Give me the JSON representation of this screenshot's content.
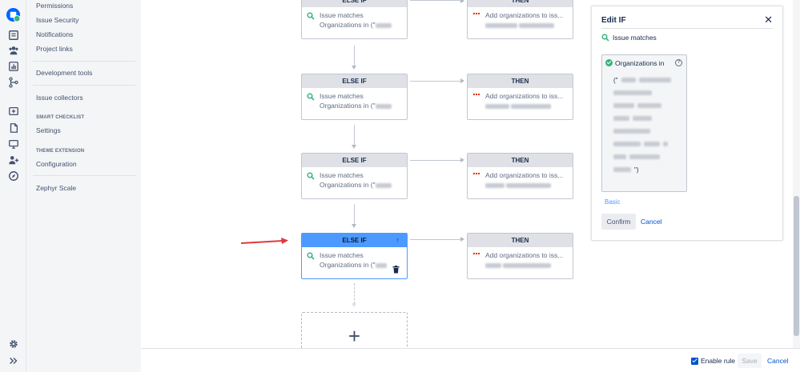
{
  "sidebar": {
    "items": [
      {
        "label": "Permissions"
      },
      {
        "label": "Issue Security"
      },
      {
        "label": "Notifications"
      },
      {
        "label": "Project links"
      },
      {
        "label": "Development tools"
      },
      {
        "label": "Issue collectors"
      },
      {
        "label": "Settings"
      },
      {
        "label": "Configuration"
      },
      {
        "label": "Zephyr Scale"
      }
    ],
    "sections": {
      "smart_checklist": "SMART CHECKLIST",
      "theme_extension": "THEME EXTENSION"
    }
  },
  "rule": {
    "blocks": [
      {
        "condition": {
          "header": "ELSE IF",
          "line1": "Issue matches",
          "line2": "Organizations in (\""
        },
        "action": {
          "header": "THEN",
          "line1": "Add organizations to iss..."
        }
      },
      {
        "condition": {
          "header": "ELSE IF",
          "line1": "Issue matches",
          "line2": "Organizations in (\""
        },
        "action": {
          "header": "THEN",
          "line1": "Add organizations to iss..."
        }
      },
      {
        "condition": {
          "header": "ELSE IF",
          "line1": "Issue matches",
          "line2": "Organizations in (\""
        },
        "action": {
          "header": "THEN",
          "line1": "Add organizations to iss..."
        }
      },
      {
        "condition": {
          "header": "ELSE IF",
          "line1": "Issue matches",
          "line2": "Organizations in (\""
        },
        "action": {
          "header": "THEN",
          "line1": "Add organizations to iss..."
        }
      }
    ],
    "add_symbol": "+"
  },
  "edit_panel": {
    "title": "Edit IF",
    "close_symbol": "✕",
    "condition_label": "Issue matches",
    "query_label": "Organizations in",
    "query_open": "(\"",
    "query_close": "\")",
    "help_symbol": "?",
    "basic_link": "Basic",
    "confirm_label": "Confirm",
    "cancel_label": "Cancel"
  },
  "footer": {
    "enable_label": "Enable rule",
    "save_label": "Save",
    "cancel_label": "Cancel"
  },
  "colors": {
    "accent": "#4c9aff",
    "link": "#0052cc",
    "success": "#36b37e",
    "annotation_arrow": "#e03a3a"
  }
}
